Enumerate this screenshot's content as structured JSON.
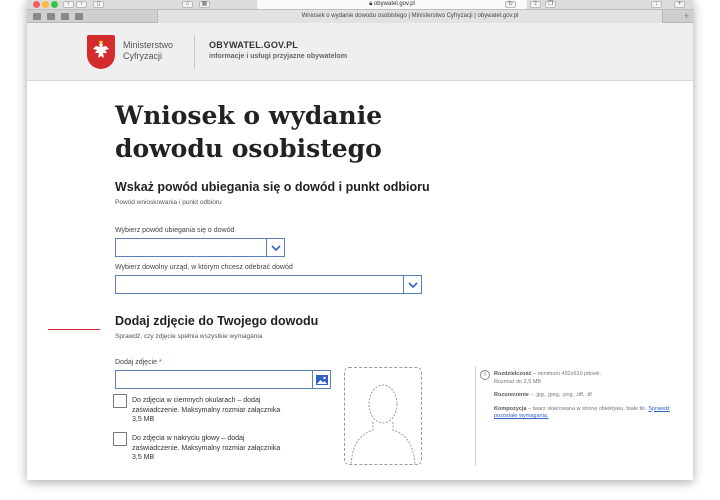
{
  "browser": {
    "url": "obywatel.gov.pl",
    "tab_title": "Wniosek o wydanie dowodu osobistego | Ministerstwo Cyfryzacji | obywatel.gov.pl"
  },
  "header": {
    "ministry_line1": "Ministerstwo",
    "ministry_line2": "Cyfryzacji",
    "brand": "OBYWATEL.GOV.PL",
    "brand_subtitle": "informacje i usługi przyjazne obywatelom"
  },
  "main": {
    "title_line1": "Wniosek o wydanie",
    "title_line2": "dowodu osobistego",
    "section1": {
      "heading": "Wskaż powód ubiegania się o dowód i punkt odbioru",
      "hint": "Powód wnioskowania i punkt odbioru",
      "reason_label": "Wybierz powód ubiegania się o dowód",
      "reason_value": "",
      "office_label": "Wybierz dowolny urząd, w którym chcesz odebrać dowód",
      "office_value": ""
    },
    "section2": {
      "heading": "Dodaj zdjęcie do Twojego dowodu",
      "hint": "Sprawdź, czy zdjęcie spełnia wszystkie wymagania",
      "photo_label": "Dodaj zdjęcie",
      "required_mark": "*",
      "photo_value": "",
      "checkbox1": "Do zdjęcia w ciemnych okularach – dodaj zaświadczenie. Maksymalny rozmiar załącznika 3,5 MB",
      "checkbox2": "Do zdjęcia w nakryciu głowy – dodaj zaświadczenie. Maksymalny rozmiar załącznika 3,5 MB"
    },
    "requirements": {
      "resolution_label": "Rozdzielczość",
      "resolution_text": " – minimum 492x610 pikseli.",
      "size_text": "Rozmiar do 2,5 MB",
      "extension_label": "Rozszerzenie",
      "extension_text": " – .jpg, .jpeg, .png, .tiff, .tif",
      "composition_label": "Kompozycja",
      "composition_text": " – twarz skierowana w stronę obiektywu, białe tło.",
      "link": "Sprawdź pozostałe wymagania."
    }
  }
}
